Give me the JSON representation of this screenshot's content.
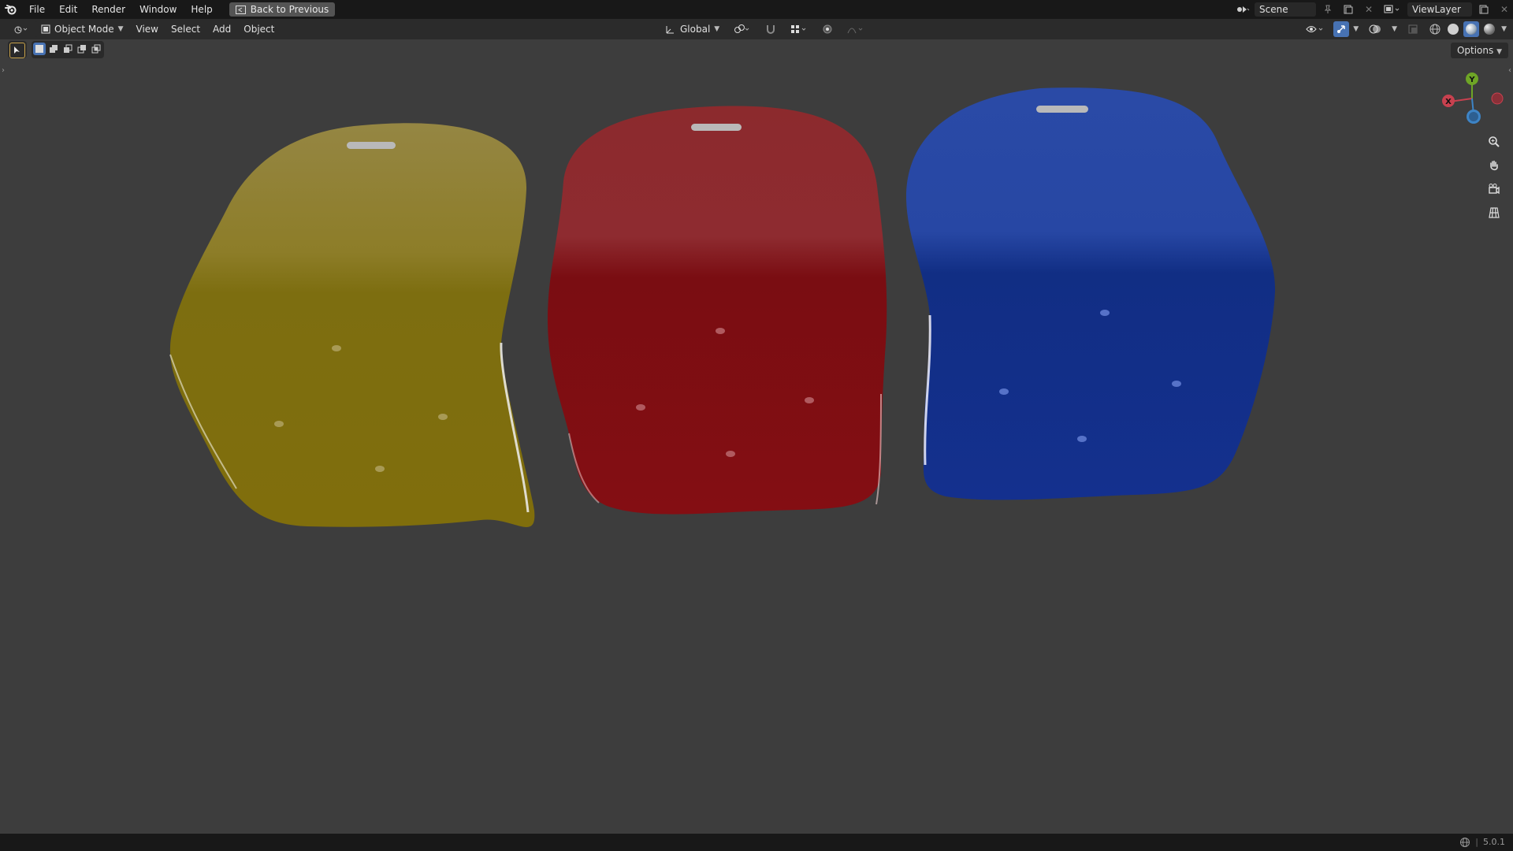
{
  "menu": {
    "items": [
      "File",
      "Edit",
      "Render",
      "Window",
      "Help"
    ],
    "back_button": "Back to Previous"
  },
  "scene": {
    "name": "Scene"
  },
  "view_layer": {
    "name": "ViewLayer"
  },
  "header": {
    "mode": "Object Mode",
    "menus": [
      "View",
      "Select",
      "Add",
      "Object"
    ],
    "transform_orientation": "Global"
  },
  "options": {
    "label": "Options"
  },
  "gizmo": {
    "x": "X",
    "y": "Y",
    "z": "Z"
  },
  "status": {
    "version": "5.0.1"
  },
  "colors": {
    "yellow_seat": "#8a7a0c",
    "red_seat": "#8a0d12",
    "blue_seat": "#14308c",
    "accent": "#4772b3",
    "axis_x": "#c8414f",
    "axis_y": "#6ea526",
    "axis_z": "#3d84c6"
  },
  "icons": {
    "editor_type": "viewport-icon",
    "zoom": "zoom-icon",
    "pan": "hand-icon",
    "camera": "camera-icon",
    "ortho": "grid-icon"
  }
}
